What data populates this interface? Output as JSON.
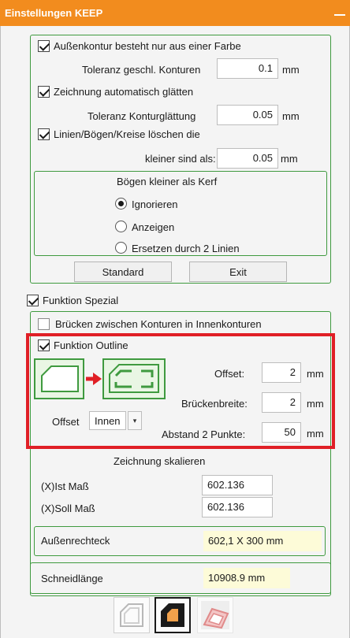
{
  "title": "Einstellungen KEEP",
  "contour": {
    "single_color_label": "Außenkontur besteht nur aus einer Farbe",
    "single_color_checked": true,
    "tol_closed_label": "Toleranz geschl. Konturen",
    "tol_closed_value": "0.1",
    "unit": "mm",
    "smooth_label": "Zeichnung automatisch glätten",
    "smooth_checked": true,
    "tol_smooth_label": "Toleranz Konturglättung",
    "tol_smooth_value": "0.05",
    "delete_label": "Linien/Bögen/Kreise löschen die",
    "delete_checked": true,
    "smaller_label": "kleiner sind als:",
    "smaller_value": "0.05"
  },
  "kerf": {
    "title": "Bögen kleiner als Kerf",
    "options": [
      "Ignorieren",
      "Anzeigen",
      "Ersetzen durch 2 Linien"
    ],
    "selected": 0
  },
  "buttons": {
    "standard": "Standard",
    "exit": "Exit"
  },
  "special": {
    "label": "Funktion Spezial",
    "checked": true,
    "bridges_label": "Brücken zwischen Konturen in Innenkonturen",
    "bridges_checked": false
  },
  "outline": {
    "label": "Funktion Outline",
    "checked": true,
    "offset_label": "Offset:",
    "offset_value": "2",
    "bridge_width_label": "Brückenbreite:",
    "bridge_width_value": "2",
    "distance_label": "Abstand 2 Punkte:",
    "distance_value": "50",
    "unit": "mm",
    "offset_mode_label": "Offset",
    "offset_mode_value": "Innen"
  },
  "scale": {
    "title": "Zeichnung skalieren",
    "ist_label": "(X)Ist Maß",
    "ist_value": "602.136",
    "soll_label": "(X)Soll Maß",
    "soll_value": "602.136",
    "rect_label": "Außenrechteck",
    "rect_value": "602,1 X 300 mm"
  },
  "cut": {
    "label": "Schneidlänge",
    "value": "10908.9 mm"
  },
  "toolbar": {
    "items": [
      "outline-view-icon",
      "filled-shape-icon",
      "3d-preview-icon"
    ],
    "active": 1
  },
  "colors": {
    "title_bar": "#f28c1e",
    "group_border": "#3f9a3f",
    "highlight": "#e01f26",
    "value_bg": "#fdfbd8"
  }
}
